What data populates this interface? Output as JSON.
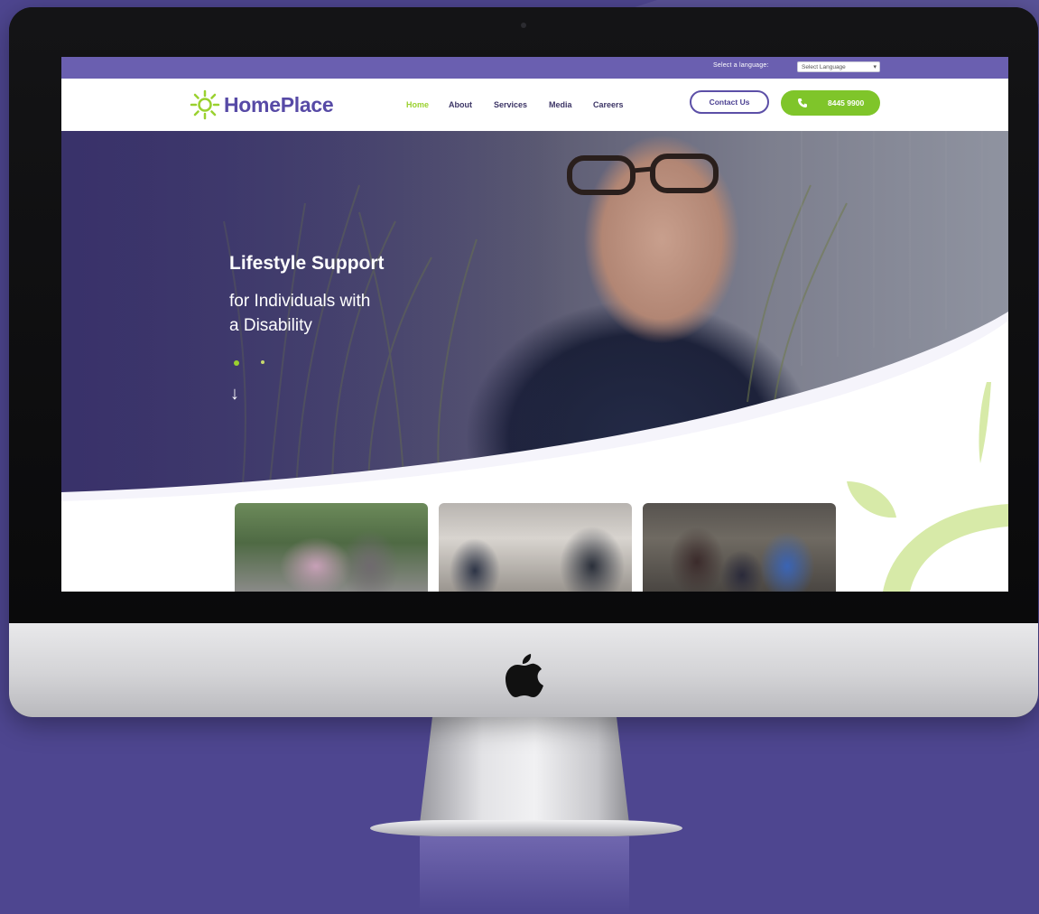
{
  "site": {
    "topbar": {
      "language_label": "Select a language:",
      "language_select_value": "Select Language"
    },
    "brand": {
      "name": "HomePlace"
    },
    "nav": {
      "items": [
        {
          "label": "Home",
          "active": true
        },
        {
          "label": "About",
          "active": false
        },
        {
          "label": "Services",
          "active": false
        },
        {
          "label": "Media",
          "active": false
        },
        {
          "label": "Careers",
          "active": false
        }
      ],
      "contact_label": "Contact Us",
      "phone_label": "8445 9900"
    },
    "hero": {
      "title": "Lifestyle Support",
      "subtitle_line1": "for Individuals with",
      "subtitle_line2": "a Disability",
      "carousel_dots": 2
    },
    "thumbnails": [
      {
        "subject": "two people outdoors"
      },
      {
        "subject": "people in cafe"
      },
      {
        "subject": "group photo"
      }
    ]
  },
  "colors": {
    "backdrop": "#4e4690",
    "brand_purple": "#574aa6",
    "brand_green": "#7fc52a",
    "topbar": "#6a5fb0",
    "nav_active": "#9ad12f"
  },
  "icons": {
    "logo": "sun-icon",
    "phone": "phone-icon",
    "scroll": "arrow-down-icon",
    "hardware": "apple-logo-icon"
  }
}
